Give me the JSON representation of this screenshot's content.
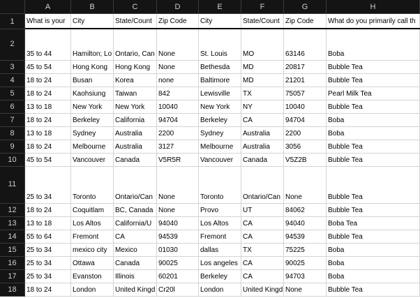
{
  "columns": [
    "A",
    "B",
    "C",
    "D",
    "E",
    "F",
    "G",
    "H"
  ],
  "rows": [
    {
      "num": "1",
      "cells": [
        "What is your",
        "City",
        "State/Count",
        "Zip Code",
        "City",
        "State/Count",
        "Zip Code",
        "What do you primarily call th"
      ]
    },
    {
      "num": "2",
      "cells": [
        "35 to 44",
        "Hamilton; Lo",
        "Ontario, Can",
        "None",
        "St. Louis",
        "MO",
        "63146",
        "Boba"
      ]
    },
    {
      "num": "3",
      "cells": [
        "45 to 54",
        "Hong Kong",
        "Hong Kong",
        "None",
        "Bethesda",
        "MD",
        "20817",
        "Bubble Tea"
      ]
    },
    {
      "num": "4",
      "cells": [
        "18 to 24",
        "Busan",
        "Korea",
        "none",
        "Baltimore",
        "MD",
        "21201",
        "Bubble Tea"
      ]
    },
    {
      "num": "5",
      "cells": [
        "18 to 24",
        "Kaohsiung",
        "Taiwan",
        "842",
        "Lewisville",
        "TX",
        "75057",
        "Pearl Milk Tea"
      ]
    },
    {
      "num": "6",
      "cells": [
        "13 to 18",
        "New York",
        "New York",
        "10040",
        "New York",
        "NY",
        "10040",
        "Bubble Tea"
      ]
    },
    {
      "num": "7",
      "cells": [
        "18 to 24",
        "Berkeley",
        "California",
        "94704",
        "Berkeley",
        "CA",
        "94704",
        "Boba"
      ]
    },
    {
      "num": "8",
      "cells": [
        "13 to 18",
        "Sydney",
        "Australia",
        "2200",
        "Sydney",
        "Australia",
        "2200",
        "Boba"
      ]
    },
    {
      "num": "9",
      "cells": [
        "18 to 24",
        "Melbourne",
        "Australia",
        "3127",
        "Melbourne",
        "Australia",
        "3056",
        "Bubble Tea"
      ]
    },
    {
      "num": "10",
      "cells": [
        "45 to 54",
        "Vancouver",
        "Canada",
        "V5R5R",
        "Vancouver",
        "Canada",
        "V5Z2B",
        "Bubble Tea"
      ]
    },
    {
      "num": "11",
      "cells": [
        "25 to 34",
        "Toronto",
        "Ontario/Can",
        "None",
        "Toronto",
        "Ontario/Can",
        "None",
        "Bubble Tea"
      ]
    },
    {
      "num": "12",
      "cells": [
        "18 to 24",
        "Coquitlam",
        "BC, Canada",
        "None",
        "Provo",
        "UT",
        "84062",
        "Bubble Tea"
      ]
    },
    {
      "num": "13",
      "cells": [
        "13 to 18",
        "Los Altos",
        "California/U",
        "94040",
        "Los Altos",
        "CA",
        "94040",
        "Boba Tea"
      ]
    },
    {
      "num": "14",
      "cells": [
        "55 to 64",
        "Fremont",
        "CA",
        "94539",
        "Fremont",
        "CA",
        "94539",
        "Bubble Tea"
      ]
    },
    {
      "num": "15",
      "cells": [
        "25 to 34",
        "mexico city",
        "Mexico",
        "01030",
        "dallas",
        "TX",
        "75225",
        "Boba"
      ]
    },
    {
      "num": "16",
      "cells": [
        "25 to 34",
        "Ottawa",
        "Canada",
        "90025",
        "Los angeles",
        "CA",
        "90025",
        "Boba"
      ]
    },
    {
      "num": "17",
      "cells": [
        "25 to 34",
        "Evanston",
        "Illinois",
        "60201",
        "Berkeley",
        "CA",
        "94703",
        "Boba"
      ]
    },
    {
      "num": "18",
      "cells": [
        "18 to 24",
        "London",
        "United Kingd",
        "Cr20l",
        "London",
        "United Kingd",
        "None",
        "Bubble Tea"
      ]
    }
  ]
}
